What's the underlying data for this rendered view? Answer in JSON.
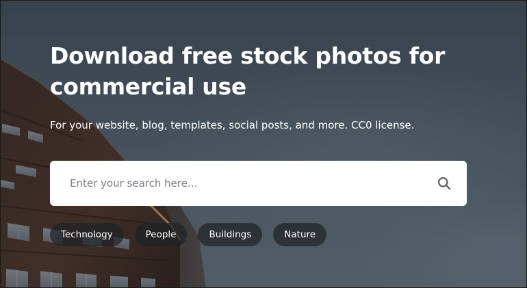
{
  "hero": {
    "title": "Download free stock photos for commercial use",
    "subtitle": "For your website, blog, templates, social posts, and more. CC0 license."
  },
  "search": {
    "placeholder": "Enter your search here...",
    "value": "",
    "icon": "search-icon"
  },
  "tags": [
    {
      "label": "Technology"
    },
    {
      "label": "People"
    },
    {
      "label": "Buildings"
    },
    {
      "label": "Nature"
    }
  ],
  "colors": {
    "sky": "#4d5966",
    "search_bg": "#ffffff",
    "tag_bg": "#1e2226",
    "text": "#ffffff"
  }
}
